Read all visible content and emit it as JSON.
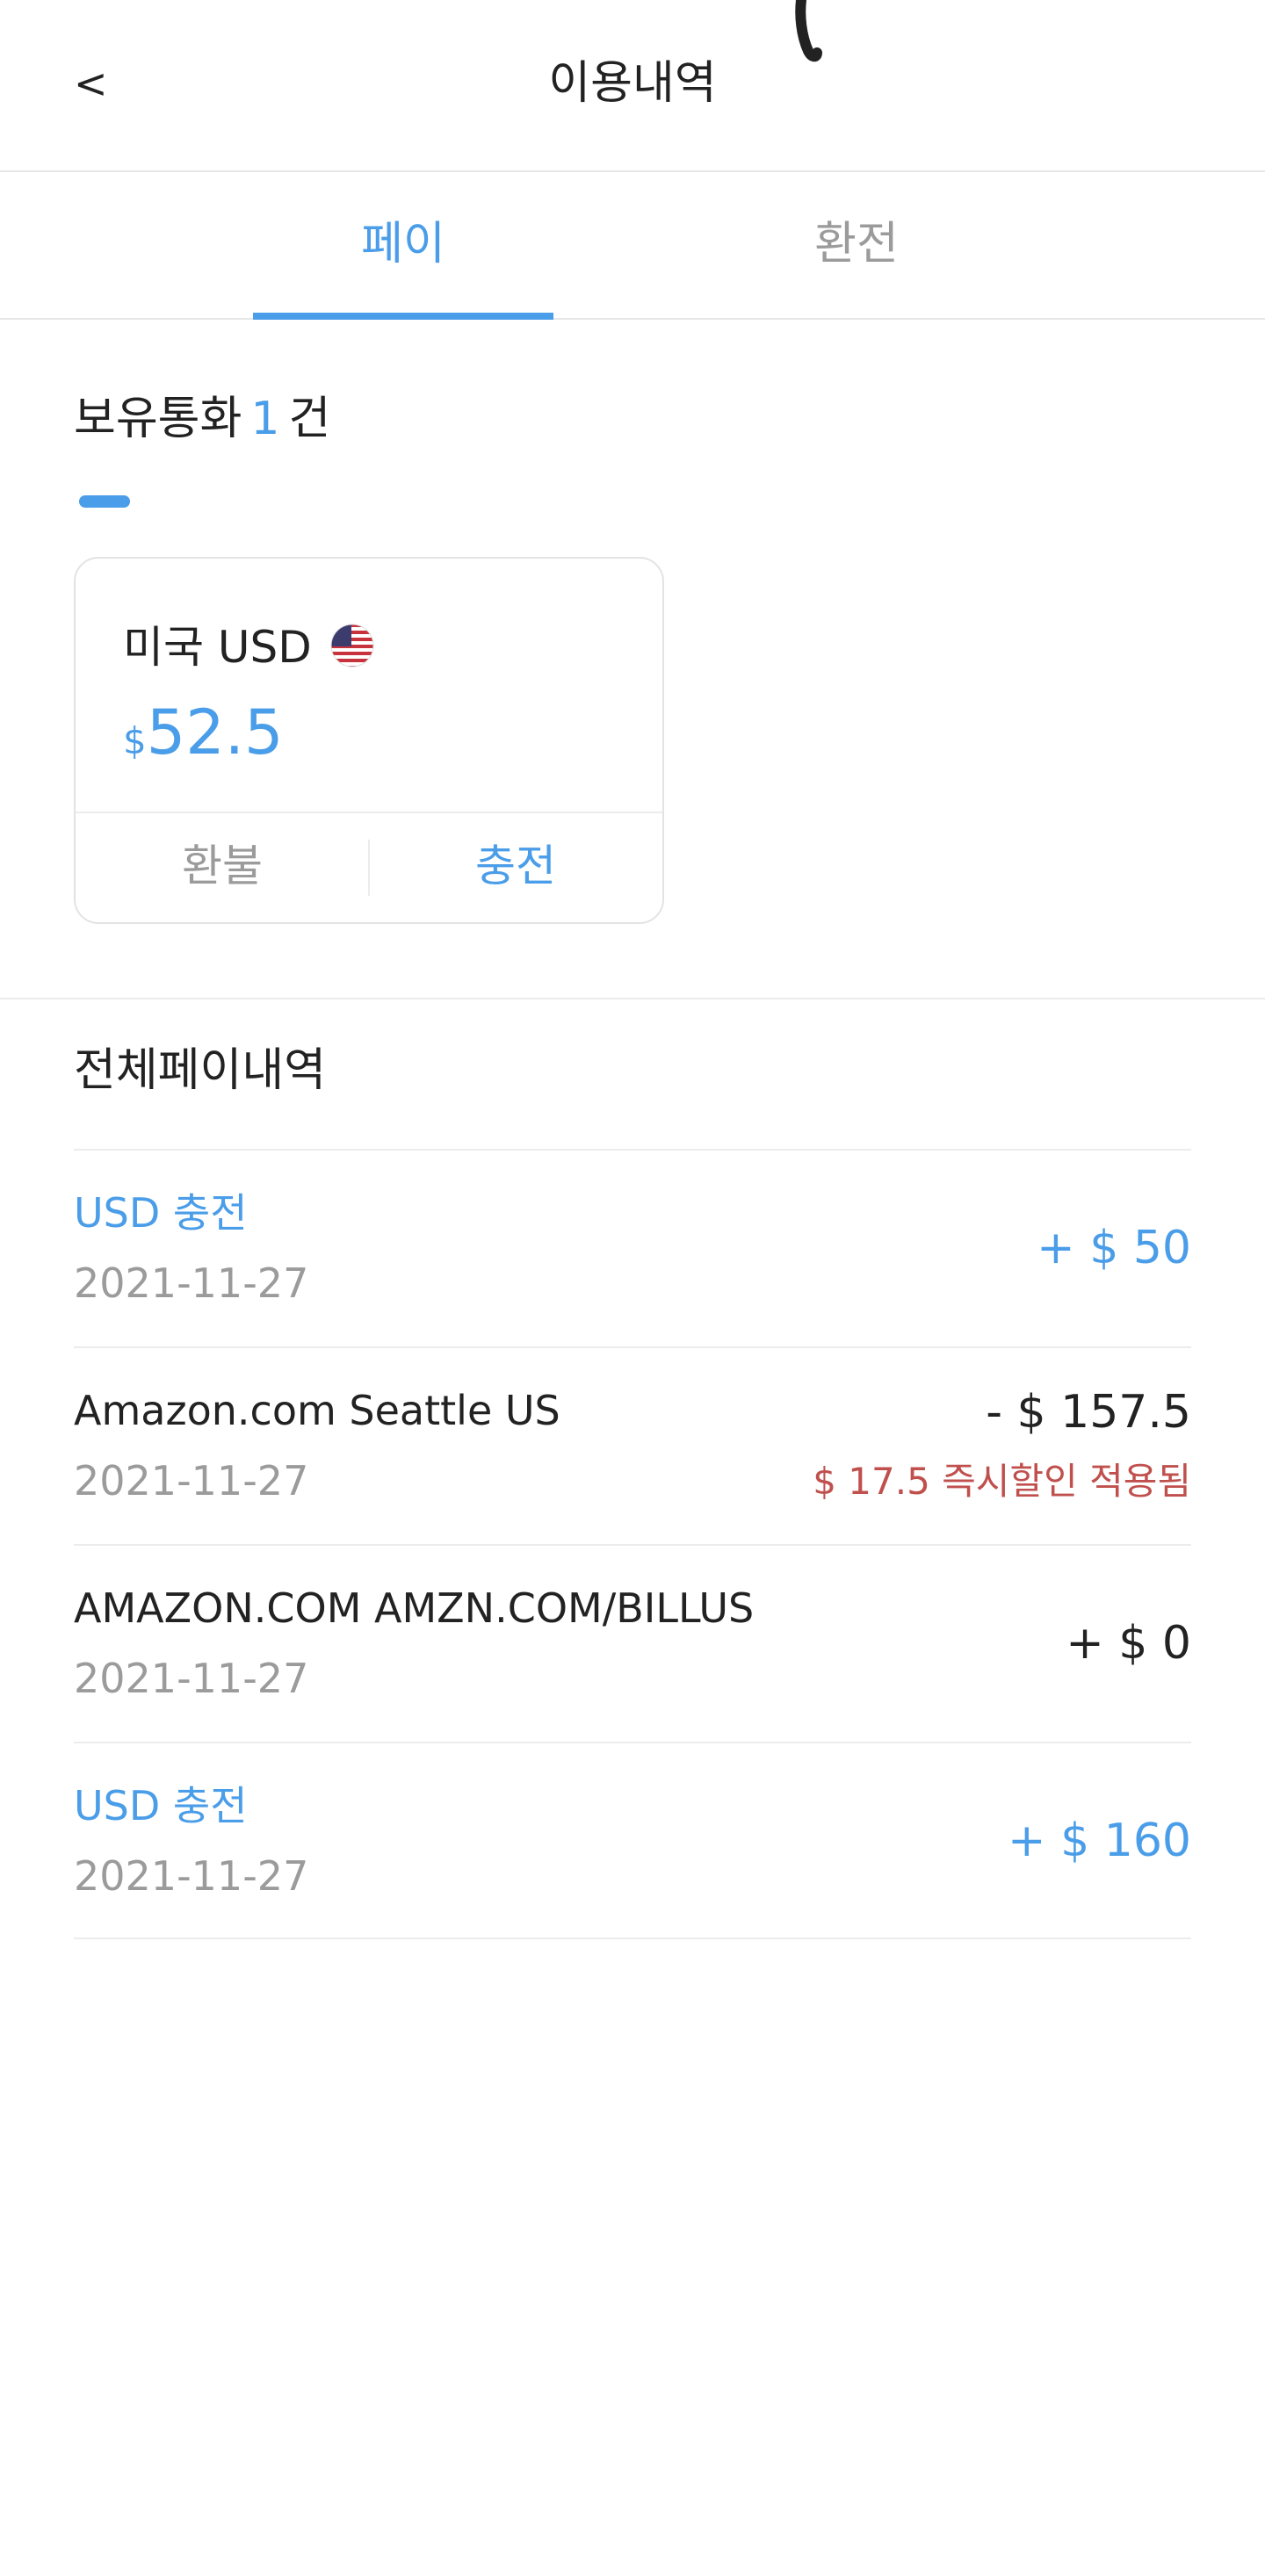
{
  "header": {
    "back": "<",
    "title": "이용내역"
  },
  "tabs": [
    {
      "label": "페이",
      "active": true
    },
    {
      "label": "환전",
      "active": false
    }
  ],
  "holdings": {
    "label": "보유통화",
    "count": "1",
    "unit": "건",
    "card": {
      "currency": "미국 USD",
      "flag_icon": "us-flag-icon",
      "symbol": "$",
      "amount": "52.5",
      "refund_label": "환불",
      "charge_label": "충전"
    }
  },
  "history": {
    "title": "전체페이내역",
    "rows": [
      {
        "title": "USD 충전",
        "date": "2021-11-27",
        "amount": "+ $ 50",
        "note": ""
      },
      {
        "title": "Amazon.com Seattle US",
        "date": "2021-11-27",
        "amount": "- $ 157.5",
        "note": "$ 17.5 즉시할인 적용됨"
      },
      {
        "title": "AMAZON.COM AMZN.COM/BILLUS",
        "date": "2021-11-27",
        "amount": "+ $ 0",
        "note": ""
      },
      {
        "title": "USD 충전",
        "date": "2021-11-27",
        "amount": "+ $ 160",
        "note": ""
      }
    ]
  },
  "colors": {
    "accent": "#4a9de8",
    "discount": "#c0504d",
    "muted": "#9b9b9b"
  }
}
